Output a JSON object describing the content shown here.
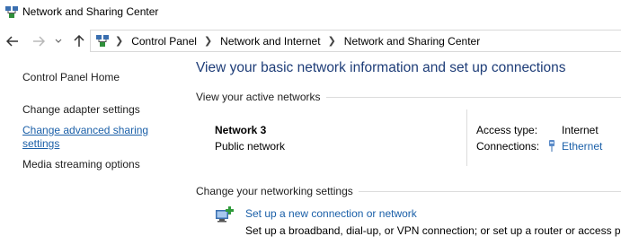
{
  "window": {
    "title": "Network and Sharing Center"
  },
  "address_bar": {
    "crumbs": [
      "Control Panel",
      "Network and Internet",
      "Network and Sharing Center"
    ]
  },
  "sidebar": {
    "items": [
      {
        "label": "Control Panel Home"
      },
      {
        "label": "Change adapter settings"
      },
      {
        "label": "Change advanced sharing settings"
      },
      {
        "label": "Media streaming options"
      }
    ]
  },
  "main": {
    "heading": "View your basic network information and set up connections",
    "active_networks_label": "View your active networks",
    "network": {
      "name": "Network 3",
      "category": "Public network",
      "access_type_label": "Access type:",
      "access_type_value": "Internet",
      "connections_label": "Connections:",
      "connections_value": "Ethernet"
    },
    "change_settings_label": "Change your networking settings",
    "setup": {
      "link": "Set up a new connection or network",
      "description": "Set up a broadband, dial-up, or VPN connection; or set up a router or access poi"
    }
  },
  "colors": {
    "link": "#1a5fa8",
    "heading": "#1e3d78"
  },
  "icons": [
    "network-center-icon",
    "back-arrow-icon",
    "forward-arrow-icon",
    "chevron-down-icon",
    "up-arrow-icon",
    "ethernet-icon",
    "new-connection-icon"
  ]
}
